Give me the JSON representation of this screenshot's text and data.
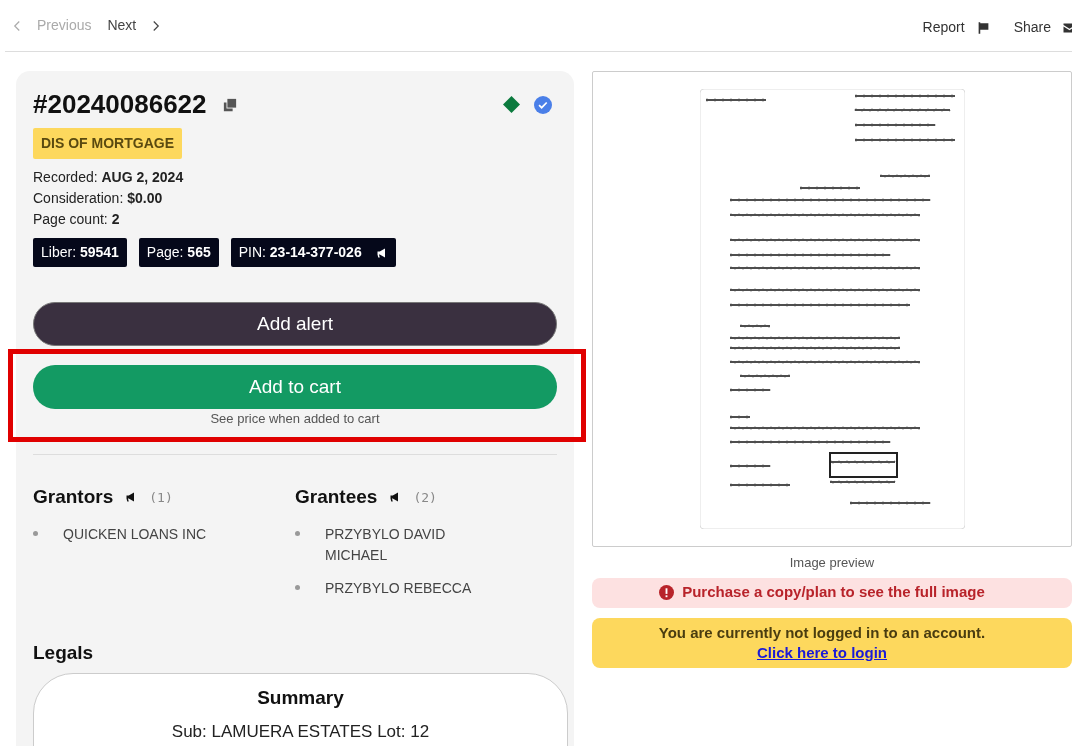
{
  "nav": {
    "previous": {
      "label": "Previous",
      "disabled": true
    },
    "next": {
      "label": "Next",
      "disabled": false
    },
    "actions": [
      {
        "label": "Report",
        "kind": "flag"
      },
      {
        "label": "Share",
        "kind": "mail"
      }
    ]
  },
  "record": {
    "number": "#20240086622",
    "tag": "DIS OF MORTGAGE",
    "details": [
      {
        "label": "Recorded:",
        "value": "AUG 2, 2024"
      },
      {
        "label": "Consideration:",
        "value": "$0.00"
      },
      {
        "label": "Page count:",
        "value": "2"
      }
    ],
    "badges": [
      {
        "label": "Liber:",
        "value": "59541",
        "kind": "plain"
      },
      {
        "label": "Page:",
        "value": "565",
        "kind": "plain"
      },
      {
        "label": "PIN:",
        "value": "23-14-377-026",
        "kind": "announce"
      }
    ]
  },
  "buttons": {
    "add_alert": "Add alert",
    "add_to_cart": "Add to cart",
    "cart_note": "See price when added to cart",
    "highlighted": true
  },
  "parties": [
    {
      "title": "Grantors",
      "count": "(1)",
      "names": [
        "QUICKEN LOANS INC"
      ]
    },
    {
      "title": "Grantees",
      "count": "(2)",
      "names": [
        "PRZYBYLO DAVID MICHAEL",
        "PRZYBYLO REBECCA"
      ]
    }
  ],
  "legals": {
    "title": "Legals",
    "summary": {
      "title": "Summary",
      "text": "Sub: LAMUERA ESTATES Lot: 12"
    }
  },
  "preview": {
    "caption": "Image preview",
    "warning": "Purchase a copy/plan to see the full image",
    "login": {
      "message": "You are currently not logged in to an account.",
      "link": "Click here to login"
    }
  }
}
